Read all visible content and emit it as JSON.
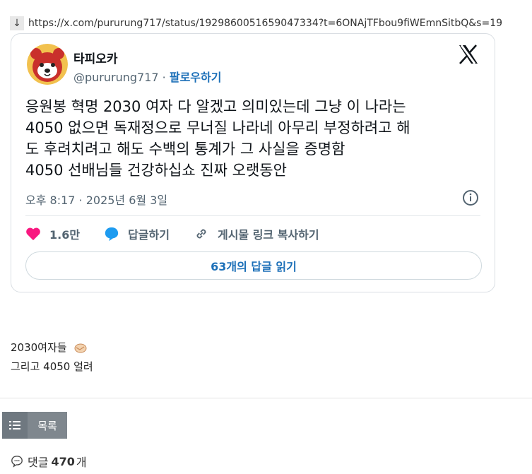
{
  "link": {
    "arrow": "↓",
    "url": "https://x.com/pururung717/status/1929860051659047334?t=6ONAjTFbou9fiWEmnSitbQ&s=19"
  },
  "tweet": {
    "name": "타피오카",
    "handle": "@pururung717",
    "separator": "·",
    "follow_label": "팔로우하기",
    "text_lines": [
      "응원봉 혁명 2030 여자 다 알겠고 의미있는데 그냥 이 나라는",
      "4050 없으면 독재정으로 무너질 나라네 아무리 부정하려고 해",
      "도 후려치려고 해도 수백의 통계가 그 사실을 증명함",
      "4050 선배님들 건강하십쇼 진짜 오랫동안"
    ],
    "timestamp": "오후 8:17 · 2025년 6월 3일",
    "likes": "1.6만",
    "reply_label": "답글하기",
    "copy_link_label": "게시물 링크 복사하기",
    "read_replies_label": "63개의 답글 읽기"
  },
  "post": {
    "line1": "2030여자들",
    "line2": "그리고 4050 얼려"
  },
  "list_button": {
    "label": "목록"
  },
  "comments": {
    "prefix": "댓글",
    "count": "470",
    "suffix": "개"
  },
  "colors": {
    "like": "#f91880",
    "reply": "#1d9bf0",
    "link_blue": "#1d70b8",
    "button_gray": "#7f878e"
  }
}
